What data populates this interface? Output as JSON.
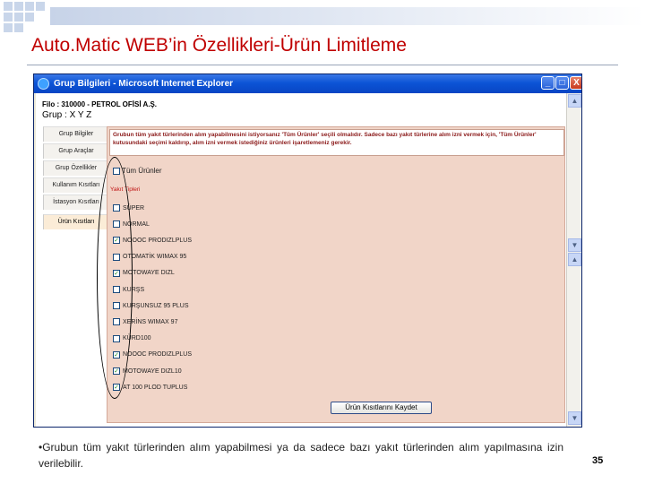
{
  "slide": {
    "title": "Auto.Matic WEB’in Özellikleri-Ürün Limitleme",
    "note": "Grubun tüm yakıt türlerinden alım yapabilmesi ya da sadece bazı yakıt türlerinden alım yapılmasına izin verilebilir.",
    "note_bullet": "•",
    "page_number": "35"
  },
  "window": {
    "title": "Grup Bilgileri - Microsoft Internet Explorer",
    "min_label": "_",
    "max_label": "□",
    "close_label": "X"
  },
  "header": {
    "firma": "Filo : 310000 - PETROL OFİSİ A.Ş.",
    "grup": "Grup : X Y Z"
  },
  "nav": {
    "items": [
      {
        "label": "Grup Bilgiler"
      },
      {
        "label": "Grup Araçlar"
      },
      {
        "label": "Grup Özellikler"
      },
      {
        "label": "Kullanım Kısıtları"
      },
      {
        "label": "İstasyon Kısıtları"
      },
      {
        "label": "Ürün Kısıtları"
      }
    ]
  },
  "panel": {
    "description": "Grubun tüm yakıt türlerinden alım yapabilmesini istiyorsanız 'Tüm Ürünler' seçili olmalıdır. Sadece bazı yakıt türlerine alım izni vermek için, 'Tüm Ürünler' kutusundaki seçimi kaldırıp, alım izni vermek istediğiniz ürünleri işaretlemeniz gerekir.",
    "all_products_label": "Tüm Ürünler",
    "types_label": "Yakıt Tipleri",
    "save_label": "Ürün Kısıtlarını Kaydet",
    "fuels": [
      {
        "name": "SÜPER",
        "checked": false
      },
      {
        "name": "NORMAL",
        "checked": false
      },
      {
        "name": "NOOOC PRODIZLPLUS",
        "checked": true
      },
      {
        "name": "OTOMATİK WIMAX 95",
        "checked": false
      },
      {
        "name": "MOTOWAYE DIZL",
        "checked": true
      },
      {
        "name": "KURŞS",
        "checked": false
      },
      {
        "name": "KURŞUNSUZ 95 PLUS",
        "checked": false
      },
      {
        "name": "XERİNS WIMAX 97",
        "checked": false
      },
      {
        "name": "KÜRD100",
        "checked": false
      },
      {
        "name": "NOOOC PRODIZLPLUS",
        "checked": true
      },
      {
        "name": "MOTOWAYE DIZL10",
        "checked": true
      },
      {
        "name": "AT 100 PLOD TUPLUS",
        "checked": true
      }
    ]
  }
}
